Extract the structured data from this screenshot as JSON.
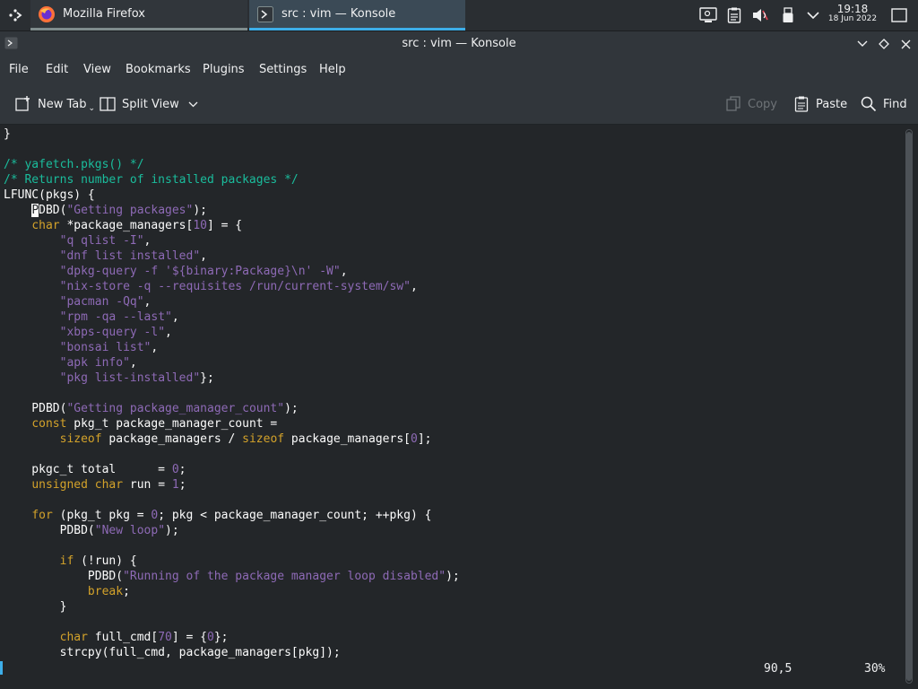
{
  "taskbar": {
    "tasks": [
      {
        "label": "Mozilla Firefox"
      },
      {
        "label": "src : vim — Konsole"
      }
    ],
    "clock": {
      "time": "19:18",
      "date": "18 Jun 2022"
    }
  },
  "window": {
    "title": "src : vim — Konsole"
  },
  "menu": [
    "File",
    "Edit",
    "View",
    "Bookmarks",
    "Plugins",
    "Settings",
    "Help"
  ],
  "toolbar": {
    "new_tab": "New Tab",
    "split_view": "Split View",
    "copy": "Copy",
    "paste": "Paste",
    "find": "Find"
  },
  "colors": {
    "accent": "#3daee9",
    "comment": "#1abc9c",
    "keyword": "#d3a22a",
    "string": "#8e6ab6",
    "background": "#232629"
  },
  "editor": {
    "lines": [
      "}",
      "",
      "/* yafetch.pkgs() */",
      "/* Returns number of installed packages */",
      "LFUNC(pkgs) {",
      "    PDBD(\"Getting packages\");",
      "    char *package_managers[10] = {",
      "        \"q qlist -I\",",
      "        \"dnf list installed\",",
      "        \"dpkg-query -f '${binary:Package}\\n' -W\",",
      "        \"nix-store -q --requisites /run/current-system/sw\",",
      "        \"pacman -Qq\",",
      "        \"rpm -qa --last\",",
      "        \"xbps-query -l\",",
      "        \"bonsai list\",",
      "        \"apk info\",",
      "        \"pkg list-installed\"};",
      "",
      "    PDBD(\"Getting package_manager_count\");",
      "    const pkg_t package_manager_count =",
      "        sizeof package_managers / sizeof package_managers[0];",
      "",
      "    pkgc_t total      = 0;",
      "    unsigned char run = 1;",
      "",
      "    for (pkg_t pkg = 0; pkg < package_manager_count; ++pkg) {",
      "        PDBD(\"New loop\");",
      "",
      "        if (!run) {",
      "            PDBD(\"Running of the package manager loop disabled\");",
      "            break;",
      "        }",
      "",
      "        char full_cmd[70] = {0};",
      "        strcpy(full_cmd, package_managers[pkg]);"
    ],
    "status": {
      "position": "90,5",
      "percent": "30%"
    }
  }
}
